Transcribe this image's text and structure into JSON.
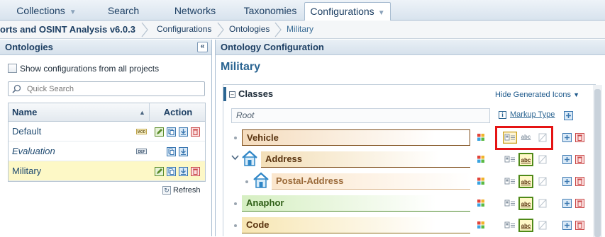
{
  "topnav": {
    "tabs": [
      {
        "label": "Collections",
        "has_dropdown": true
      },
      {
        "label": "Search",
        "has_dropdown": false
      },
      {
        "label": "Networks",
        "has_dropdown": false
      },
      {
        "label": "Taxonomies",
        "has_dropdown": false
      },
      {
        "label": "Configurations",
        "has_dropdown": true,
        "active": true
      }
    ]
  },
  "breadcrumb": [
    "orts and OSINT Analysis v6.0.3",
    "Configurations",
    "Ontologies",
    "Military"
  ],
  "left": {
    "title": "Ontologies",
    "collapse_glyph": "«",
    "show_all_label": "Show configurations from all projects",
    "search_placeholder": "Quick Search",
    "columns": {
      "name": "Name",
      "action": "Action"
    },
    "rows": [
      {
        "name": "Default",
        "badge": "MOD",
        "italic": false,
        "selected": false
      },
      {
        "name": "Evaluation",
        "badge": "DEF",
        "italic": true,
        "selected": false
      },
      {
        "name": "Military",
        "badge": "",
        "italic": false,
        "selected": true
      }
    ],
    "refresh_label": "Refresh"
  },
  "right": {
    "header": "Ontology Configuration",
    "title": "Military",
    "section_title": "Classes",
    "hide_generated": "Hide Generated Icons",
    "root_label": "Root",
    "markup_type_label": "Markup Type",
    "classes": [
      {
        "name": "Vehicle",
        "color": "#f5dcbd",
        "border": "#7b4a15",
        "text_color": "#5a3410",
        "level": 0,
        "expandable": false,
        "icon": false
      },
      {
        "name": "Address",
        "color": "#f3dfb8",
        "border": "#7b4a15",
        "text_color": "#5a3410",
        "level": 0,
        "expandable": true,
        "icon": "house-icon"
      },
      {
        "name": "Postal-Address",
        "color": "#fbe6cc",
        "border": "#d9b48a",
        "text_color": "#9a6a3a",
        "level": 1,
        "expandable": false,
        "icon": "house-icon"
      },
      {
        "name": "Anaphor",
        "color": "#d6efc2",
        "border": "#4c8a2a",
        "text_color": "#2f5f17",
        "level": 0,
        "expandable": false,
        "icon": false
      },
      {
        "name": "Code",
        "color": "#f7e6b3",
        "border": "#8a6a15",
        "text_color": "#5a3410",
        "level": 0,
        "expandable": false,
        "icon": false
      }
    ],
    "markup_abc": "abc"
  }
}
